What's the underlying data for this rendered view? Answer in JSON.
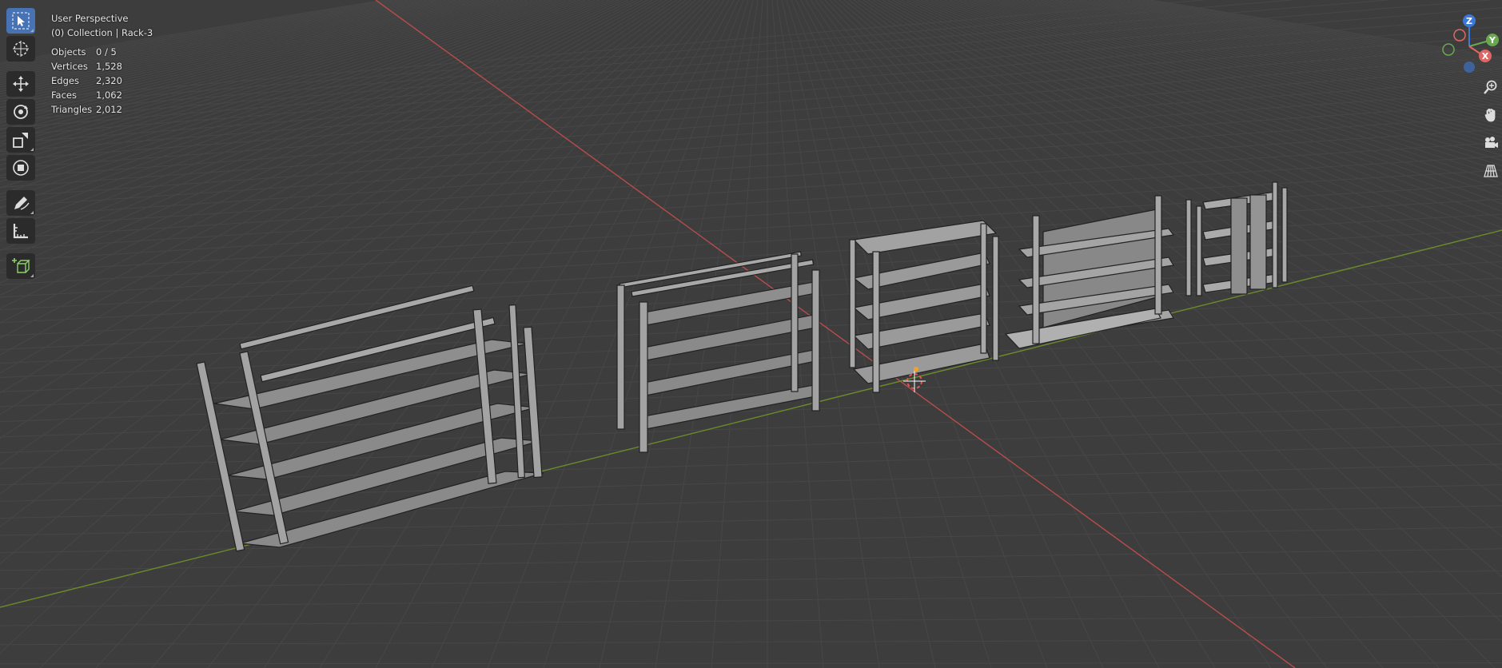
{
  "viewport": {
    "view_name": "User Perspective",
    "collection_info": "(0) Collection | Rack-3",
    "stats": [
      {
        "label": "Objects",
        "value": "0 / 5"
      },
      {
        "label": "Vertices",
        "value": "1,528"
      },
      {
        "label": "Edges",
        "value": "2,320"
      },
      {
        "label": "Faces",
        "value": "1,062"
      },
      {
        "label": "Triangles",
        "value": "2,012"
      }
    ]
  },
  "toolbar": {
    "tools": [
      "select-box",
      "cursor",
      "move",
      "rotate",
      "scale",
      "transform",
      "annotate",
      "measure",
      "add-cube"
    ],
    "active": "select-box"
  },
  "gizmo": {
    "axes": [
      {
        "label": "Z",
        "color": "#3c78d8"
      },
      {
        "label": "Y",
        "color": "#6aa84f"
      },
      {
        "label": "X",
        "color": "#e06666"
      }
    ]
  },
  "nav_buttons": [
    "zoom-icon",
    "hand-pan-icon",
    "camera-icon",
    "grid-perspective-icon"
  ],
  "colors": {
    "background": "#3d3d3d",
    "grid": "#474747",
    "x_axis": "#b84c4c",
    "y_axis": "#6b8c2a",
    "active_tool": "#4772b3"
  }
}
